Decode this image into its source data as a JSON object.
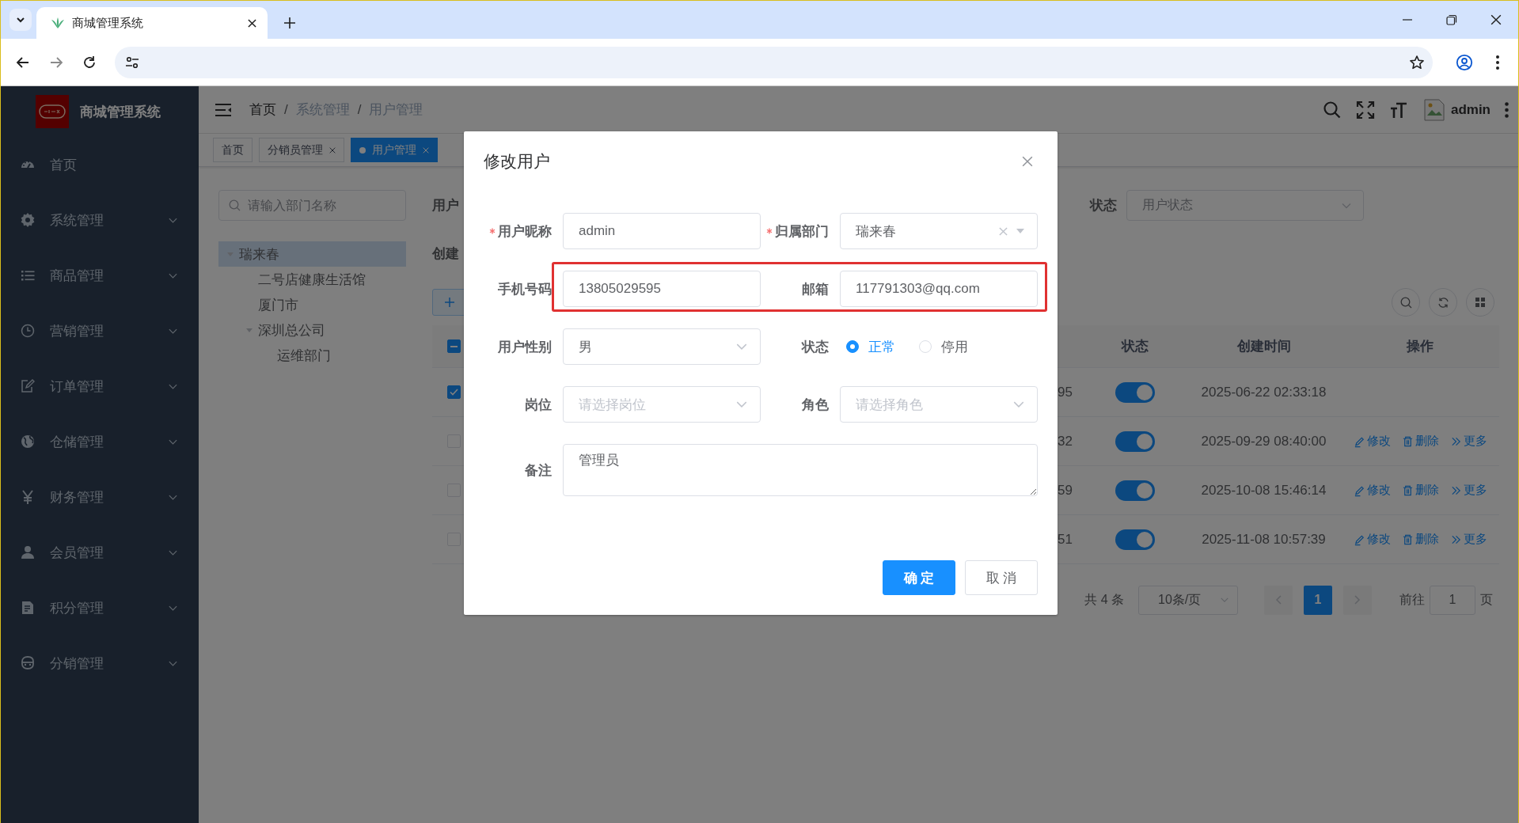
{
  "browser": {
    "tab_title": "商城管理系统"
  },
  "sidebar": {
    "title": "商城管理系统",
    "items": [
      {
        "label": "首页",
        "expandable": false
      },
      {
        "label": "系统管理",
        "expandable": true
      },
      {
        "label": "商品管理",
        "expandable": true
      },
      {
        "label": "营销管理",
        "expandable": true
      },
      {
        "label": "订单管理",
        "expandable": true
      },
      {
        "label": "仓储管理",
        "expandable": true
      },
      {
        "label": "财务管理",
        "expandable": true
      },
      {
        "label": "会员管理",
        "expandable": true
      },
      {
        "label": "积分管理",
        "expandable": true
      },
      {
        "label": "分销管理",
        "expandable": true
      }
    ]
  },
  "header": {
    "breadcrumb": [
      {
        "label": "首页",
        "link": true
      },
      {
        "separator": "/",
        "label": "系统管理",
        "link": false
      },
      {
        "separator": "/",
        "label": "用户管理",
        "link": false
      }
    ],
    "user": "admin"
  },
  "tags": [
    {
      "label": "首页",
      "selected": false,
      "closable": false
    },
    {
      "label": "分销员管理",
      "selected": false,
      "closable": true
    },
    {
      "label": "用户管理",
      "selected": true,
      "closable": true
    }
  ],
  "dept_tree": {
    "search": {
      "placeholder": "请输入部门名称"
    },
    "nodes": [
      {
        "label": "瑞来春",
        "selected": true,
        "expanded": true,
        "children": [
          {
            "label": "二号店健康生活馆",
            "selected": false
          },
          {
            "label": "厦门市",
            "selected": false
          },
          {
            "label": "深圳总公司",
            "selected": false,
            "expanded": true,
            "children": [
              {
                "label": "运维部门",
                "selected": false
              }
            ]
          }
        ]
      }
    ]
  },
  "query": {
    "label_1": "用户",
    "label_2": "创建",
    "status_label": "状态",
    "status_placeholder": "用户状态"
  },
  "table": {
    "header_checkbox": {
      "indeterminate": true
    },
    "columns": [
      "状态",
      "创建时间",
      "操作"
    ],
    "rows": [
      {
        "selected": true,
        "column_1": "95",
        "status_on": true,
        "created": "2025-06-22 02:33:18"
      },
      {
        "selected": false,
        "column_1": "32",
        "status_on": true,
        "created": "2025-09-29 08:40:00",
        "actions": [
          "修改",
          "删除",
          "更多"
        ]
      },
      {
        "selected": false,
        "column_1": "59",
        "status_on": true,
        "created": "2025-10-08 15:46:14",
        "actions": [
          "修改",
          "删除",
          "更多"
        ]
      },
      {
        "selected": false,
        "column_1": "51",
        "status_on": true,
        "created": "2025-11-08 10:57:39",
        "actions": [
          "修改",
          "删除",
          "更多"
        ]
      }
    ]
  },
  "pagination": {
    "total": "共 4 条",
    "page_size": "10条/页",
    "pages": [
      {
        "label": "1",
        "selected": true
      }
    ],
    "goto_label": "前往",
    "goto_value": "1",
    "goto_suffix": "页"
  },
  "dialog": {
    "title": "修改用户",
    "rows": [
      {
        "highlighted": false,
        "fields": [
          {
            "kind": "input",
            "label": "用户昵称",
            "required": true,
            "value": "admin"
          },
          {
            "kind": "tree-select",
            "label": "归属部门",
            "required": true,
            "value": "瑞来春"
          }
        ]
      },
      {
        "highlighted": true,
        "fields": [
          {
            "kind": "input",
            "label": "手机号码",
            "required": false,
            "value": "13805029595"
          },
          {
            "kind": "input",
            "label": "邮箱",
            "required": false,
            "value": "117791303@qq.com"
          }
        ]
      },
      {
        "highlighted": false,
        "fields": [
          {
            "kind": "select",
            "label": "用户性别",
            "required": false,
            "value": "男"
          },
          {
            "kind": "radio",
            "label": "状态",
            "required": false,
            "options": [
              {
                "label": "正常",
                "selected": true
              },
              {
                "label": "停用",
                "selected": false
              }
            ]
          }
        ]
      },
      {
        "highlighted": false,
        "fields": [
          {
            "kind": "select",
            "label": "岗位",
            "required": false,
            "placeholder": "请选择岗位"
          },
          {
            "kind": "select",
            "label": "角色",
            "required": false,
            "placeholder": "请选择角色"
          }
        ]
      },
      {
        "highlighted": false,
        "fields": [
          {
            "kind": "textarea",
            "label": "备注",
            "required": false,
            "value": "管理员"
          }
        ]
      }
    ],
    "buttons": [
      {
        "label": "确 定",
        "kind": "primary"
      },
      {
        "label": "取 消",
        "kind": "default"
      }
    ]
  }
}
